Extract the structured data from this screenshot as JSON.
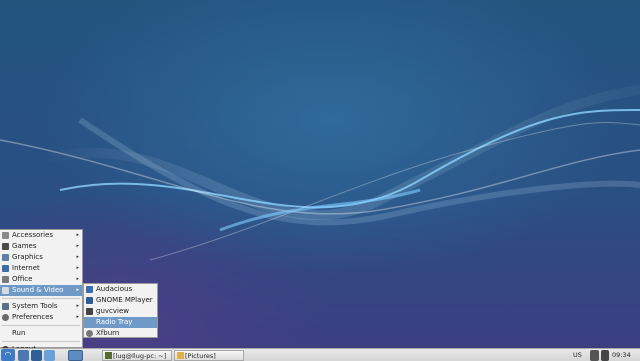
{
  "main_menu": {
    "items": [
      {
        "label": "Accessories",
        "icon": "accessories-icon",
        "submenu": true
      },
      {
        "label": "Games",
        "icon": "games-icon",
        "submenu": true
      },
      {
        "label": "Graphics",
        "icon": "graphics-icon",
        "submenu": true
      },
      {
        "label": "Internet",
        "icon": "internet-icon",
        "submenu": true
      },
      {
        "label": "Office",
        "icon": "office-icon",
        "submenu": true
      },
      {
        "label": "Sound & Video",
        "icon": "sound-video-icon",
        "submenu": true
      },
      {
        "label": "System Tools",
        "icon": "system-tools-icon",
        "submenu": true
      },
      {
        "label": "Preferences",
        "icon": "preferences-icon",
        "submenu": true
      },
      {
        "label": "Run",
        "icon": "run-icon",
        "submenu": false
      },
      {
        "label": "Logout",
        "icon": "logout-icon",
        "submenu": false
      }
    ]
  },
  "submenu": {
    "items": [
      {
        "label": "Audacious",
        "icon": "audacious-icon"
      },
      {
        "label": "GNOME MPlayer",
        "icon": "mplayer-icon"
      },
      {
        "label": "guvcview",
        "icon": "guvcview-icon"
      },
      {
        "label": "Radio Tray",
        "icon": "radio-tray-icon"
      },
      {
        "label": "Xfburn",
        "icon": "xfburn-icon"
      }
    ]
  },
  "taskbar": {
    "tasks": [
      {
        "label": "[lug@llug-pc: ~]",
        "icon": "terminal-icon"
      },
      {
        "label": "[Pictures]",
        "icon": "folder-icon"
      }
    ],
    "keyboard_layout": "US",
    "clock": "09:34",
    "arrow_glyph": "▸",
    "start_glyph": "◠"
  },
  "colors": {
    "accent": "#6f9ac8",
    "menu_bg": "#f2f2f2",
    "desktop_top": "#23557f",
    "desktop_bottom": "#3b3f82"
  }
}
